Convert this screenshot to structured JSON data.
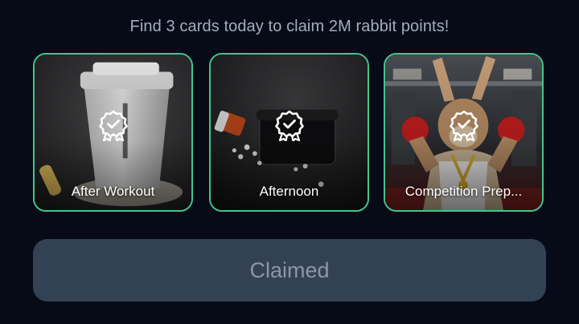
{
  "headline": "Find 3 cards today to claim 2M rabbit points!",
  "cards": [
    {
      "label": "After Workout",
      "icon": "award-badge-icon",
      "image": "protein-shaker-cup"
    },
    {
      "label": "Afternoon",
      "icon": "award-badge-icon",
      "image": "pill-bottle-and-lunchbox"
    },
    {
      "label": "Competition Prep...",
      "icon": "award-badge-icon",
      "image": "muscular-rabbit-boxer"
    }
  ],
  "claim_button": {
    "label": "Claimed",
    "state": "disabled"
  },
  "colors": {
    "background": "#060b17",
    "card_border": "#43c58b",
    "button_bg": "#334155",
    "button_text": "#8b97a8",
    "headline_text": "#a3adbf"
  }
}
